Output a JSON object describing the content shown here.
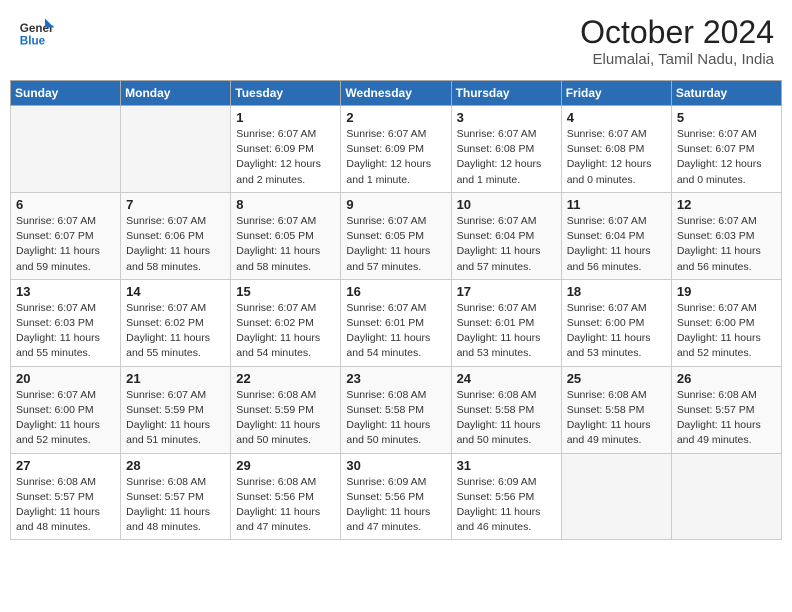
{
  "logo": {
    "line1": "General",
    "line2": "Blue"
  },
  "title": "October 2024",
  "location": "Elumalai, Tamil Nadu, India",
  "weekdays": [
    "Sunday",
    "Monday",
    "Tuesday",
    "Wednesday",
    "Thursday",
    "Friday",
    "Saturday"
  ],
  "weeks": [
    [
      {
        "day": "",
        "empty": true
      },
      {
        "day": "",
        "empty": true
      },
      {
        "day": "1",
        "sunrise": "Sunrise: 6:07 AM",
        "sunset": "Sunset: 6:09 PM",
        "daylight": "Daylight: 12 hours and 2 minutes."
      },
      {
        "day": "2",
        "sunrise": "Sunrise: 6:07 AM",
        "sunset": "Sunset: 6:09 PM",
        "daylight": "Daylight: 12 hours and 1 minute."
      },
      {
        "day": "3",
        "sunrise": "Sunrise: 6:07 AM",
        "sunset": "Sunset: 6:08 PM",
        "daylight": "Daylight: 12 hours and 1 minute."
      },
      {
        "day": "4",
        "sunrise": "Sunrise: 6:07 AM",
        "sunset": "Sunset: 6:08 PM",
        "daylight": "Daylight: 12 hours and 0 minutes."
      },
      {
        "day": "5",
        "sunrise": "Sunrise: 6:07 AM",
        "sunset": "Sunset: 6:07 PM",
        "daylight": "Daylight: 12 hours and 0 minutes."
      }
    ],
    [
      {
        "day": "6",
        "sunrise": "Sunrise: 6:07 AM",
        "sunset": "Sunset: 6:07 PM",
        "daylight": "Daylight: 11 hours and 59 minutes."
      },
      {
        "day": "7",
        "sunrise": "Sunrise: 6:07 AM",
        "sunset": "Sunset: 6:06 PM",
        "daylight": "Daylight: 11 hours and 58 minutes."
      },
      {
        "day": "8",
        "sunrise": "Sunrise: 6:07 AM",
        "sunset": "Sunset: 6:05 PM",
        "daylight": "Daylight: 11 hours and 58 minutes."
      },
      {
        "day": "9",
        "sunrise": "Sunrise: 6:07 AM",
        "sunset": "Sunset: 6:05 PM",
        "daylight": "Daylight: 11 hours and 57 minutes."
      },
      {
        "day": "10",
        "sunrise": "Sunrise: 6:07 AM",
        "sunset": "Sunset: 6:04 PM",
        "daylight": "Daylight: 11 hours and 57 minutes."
      },
      {
        "day": "11",
        "sunrise": "Sunrise: 6:07 AM",
        "sunset": "Sunset: 6:04 PM",
        "daylight": "Daylight: 11 hours and 56 minutes."
      },
      {
        "day": "12",
        "sunrise": "Sunrise: 6:07 AM",
        "sunset": "Sunset: 6:03 PM",
        "daylight": "Daylight: 11 hours and 56 minutes."
      }
    ],
    [
      {
        "day": "13",
        "sunrise": "Sunrise: 6:07 AM",
        "sunset": "Sunset: 6:03 PM",
        "daylight": "Daylight: 11 hours and 55 minutes."
      },
      {
        "day": "14",
        "sunrise": "Sunrise: 6:07 AM",
        "sunset": "Sunset: 6:02 PM",
        "daylight": "Daylight: 11 hours and 55 minutes."
      },
      {
        "day": "15",
        "sunrise": "Sunrise: 6:07 AM",
        "sunset": "Sunset: 6:02 PM",
        "daylight": "Daylight: 11 hours and 54 minutes."
      },
      {
        "day": "16",
        "sunrise": "Sunrise: 6:07 AM",
        "sunset": "Sunset: 6:01 PM",
        "daylight": "Daylight: 11 hours and 54 minutes."
      },
      {
        "day": "17",
        "sunrise": "Sunrise: 6:07 AM",
        "sunset": "Sunset: 6:01 PM",
        "daylight": "Daylight: 11 hours and 53 minutes."
      },
      {
        "day": "18",
        "sunrise": "Sunrise: 6:07 AM",
        "sunset": "Sunset: 6:00 PM",
        "daylight": "Daylight: 11 hours and 53 minutes."
      },
      {
        "day": "19",
        "sunrise": "Sunrise: 6:07 AM",
        "sunset": "Sunset: 6:00 PM",
        "daylight": "Daylight: 11 hours and 52 minutes."
      }
    ],
    [
      {
        "day": "20",
        "sunrise": "Sunrise: 6:07 AM",
        "sunset": "Sunset: 6:00 PM",
        "daylight": "Daylight: 11 hours and 52 minutes."
      },
      {
        "day": "21",
        "sunrise": "Sunrise: 6:07 AM",
        "sunset": "Sunset: 5:59 PM",
        "daylight": "Daylight: 11 hours and 51 minutes."
      },
      {
        "day": "22",
        "sunrise": "Sunrise: 6:08 AM",
        "sunset": "Sunset: 5:59 PM",
        "daylight": "Daylight: 11 hours and 50 minutes."
      },
      {
        "day": "23",
        "sunrise": "Sunrise: 6:08 AM",
        "sunset": "Sunset: 5:58 PM",
        "daylight": "Daylight: 11 hours and 50 minutes."
      },
      {
        "day": "24",
        "sunrise": "Sunrise: 6:08 AM",
        "sunset": "Sunset: 5:58 PM",
        "daylight": "Daylight: 11 hours and 50 minutes."
      },
      {
        "day": "25",
        "sunrise": "Sunrise: 6:08 AM",
        "sunset": "Sunset: 5:58 PM",
        "daylight": "Daylight: 11 hours and 49 minutes."
      },
      {
        "day": "26",
        "sunrise": "Sunrise: 6:08 AM",
        "sunset": "Sunset: 5:57 PM",
        "daylight": "Daylight: 11 hours and 49 minutes."
      }
    ],
    [
      {
        "day": "27",
        "sunrise": "Sunrise: 6:08 AM",
        "sunset": "Sunset: 5:57 PM",
        "daylight": "Daylight: 11 hours and 48 minutes."
      },
      {
        "day": "28",
        "sunrise": "Sunrise: 6:08 AM",
        "sunset": "Sunset: 5:57 PM",
        "daylight": "Daylight: 11 hours and 48 minutes."
      },
      {
        "day": "29",
        "sunrise": "Sunrise: 6:08 AM",
        "sunset": "Sunset: 5:56 PM",
        "daylight": "Daylight: 11 hours and 47 minutes."
      },
      {
        "day": "30",
        "sunrise": "Sunrise: 6:09 AM",
        "sunset": "Sunset: 5:56 PM",
        "daylight": "Daylight: 11 hours and 47 minutes."
      },
      {
        "day": "31",
        "sunrise": "Sunrise: 6:09 AM",
        "sunset": "Sunset: 5:56 PM",
        "daylight": "Daylight: 11 hours and 46 minutes."
      },
      {
        "day": "",
        "empty": true
      },
      {
        "day": "",
        "empty": true
      }
    ]
  ]
}
